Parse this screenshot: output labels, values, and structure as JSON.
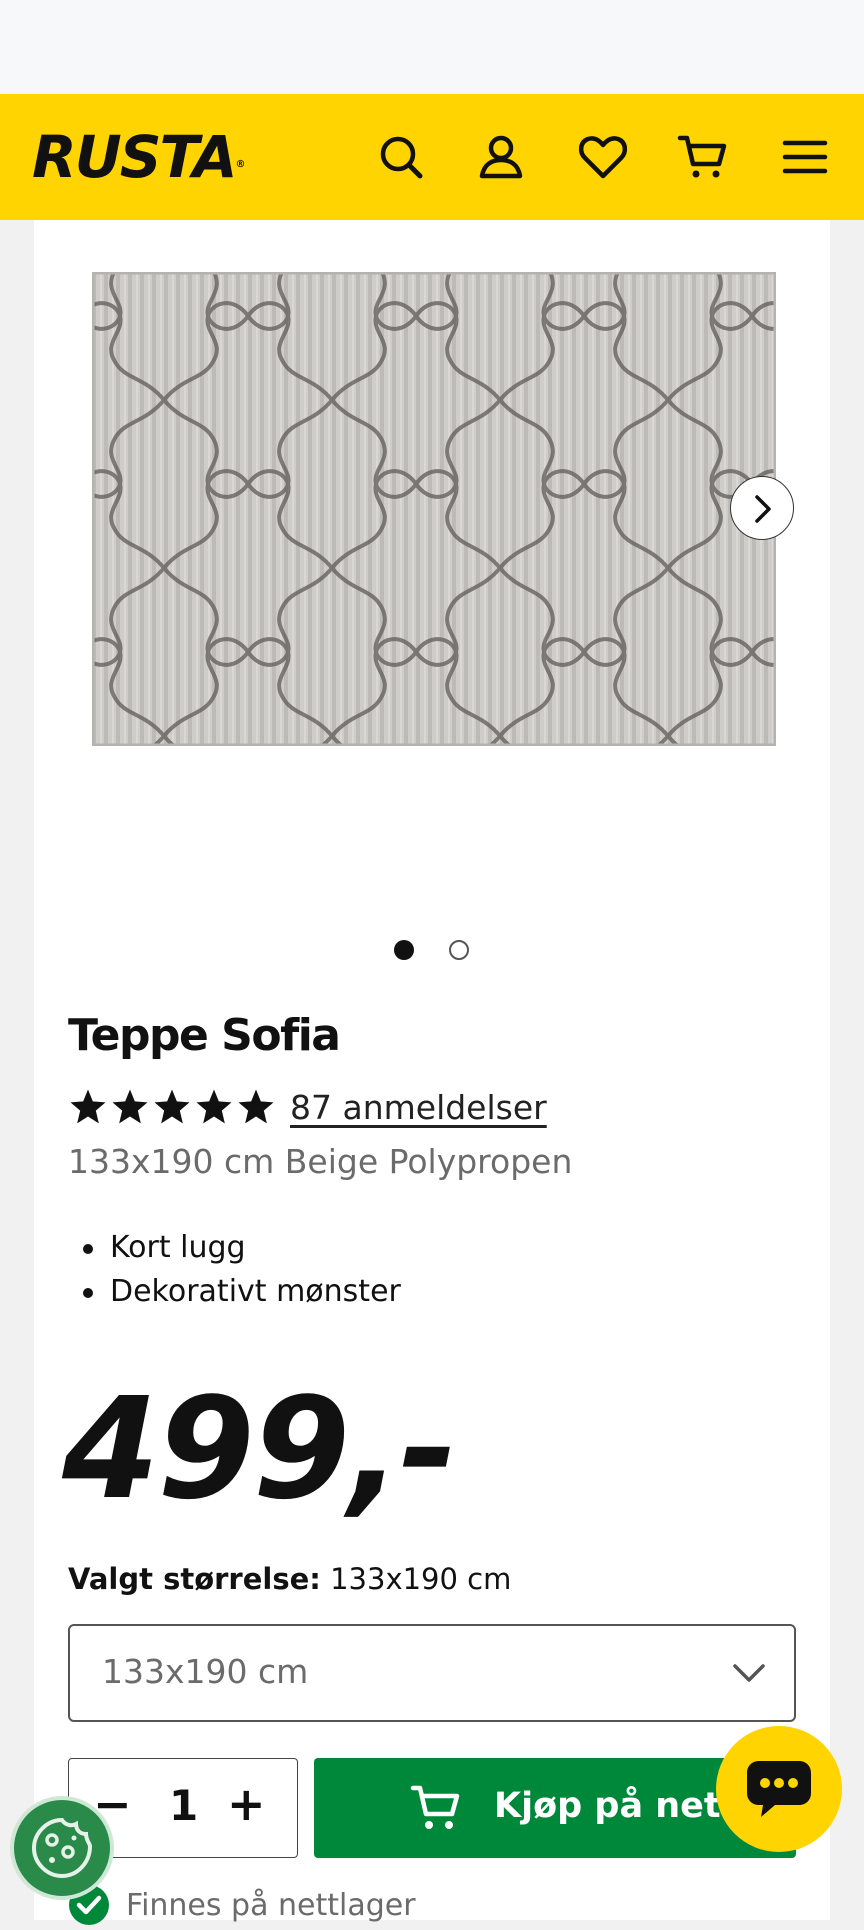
{
  "header": {
    "logo_text": "RUSTA",
    "logo_mark": "®",
    "icons": [
      "search-icon",
      "account-icon",
      "heart-icon",
      "cart-icon",
      "menu-icon"
    ],
    "background_color": "#ffd400"
  },
  "gallery": {
    "slide_count": 2,
    "active_slide": 1,
    "next_icon": "chevron-right-icon"
  },
  "product": {
    "title": "Teppe Sofia",
    "rating_stars": 5,
    "reviews_label": "87 anmeldelser",
    "subtitle": "133x190 cm Beige Polypropen",
    "features": [
      "Kort lugg",
      "Dekorativt mønster"
    ],
    "price": "499,-"
  },
  "size": {
    "label_bold": "Valgt størrelse:",
    "label_value": "133x190 cm",
    "selected": "133x190 cm"
  },
  "purchase": {
    "minus": "−",
    "quantity": "1",
    "plus": "+",
    "buy_label": "Kjøp på nett",
    "buy_color": "#00883a",
    "stock_text": "Finnes på nettlager"
  }
}
